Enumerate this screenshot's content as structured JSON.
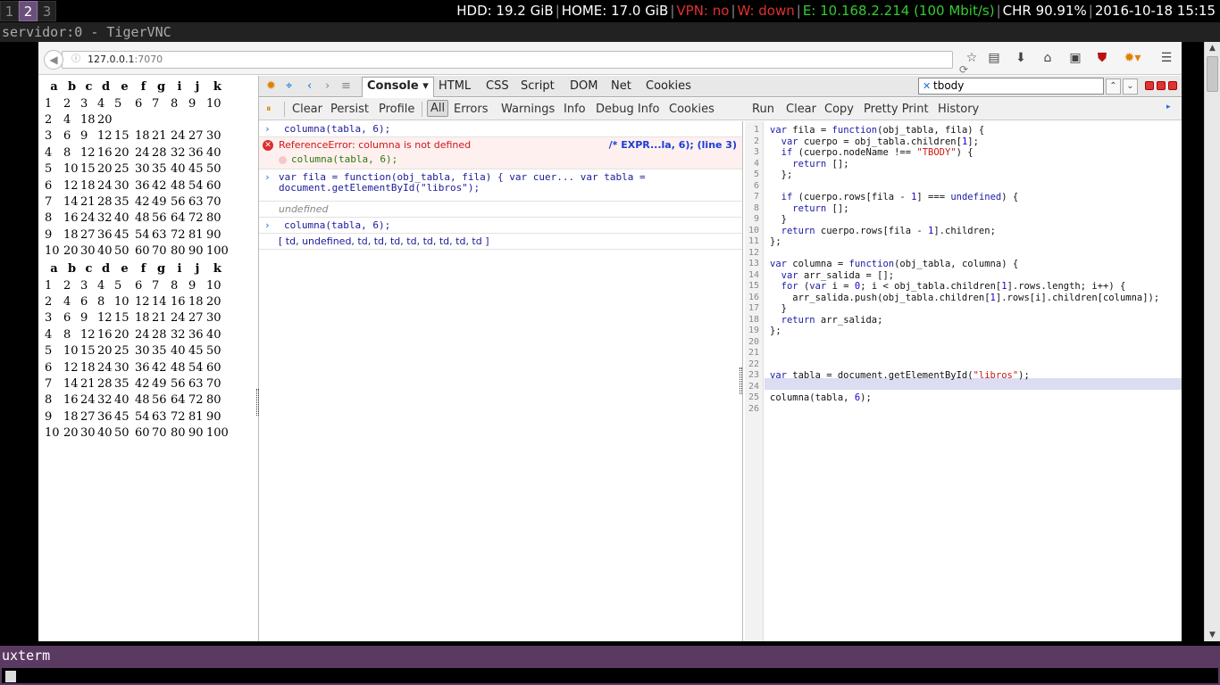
{
  "topbar": {
    "workspaces": [
      "1",
      "2",
      "3"
    ],
    "status": {
      "hdd": "HDD: 19.2 GiB",
      "home": "HOME: 17.0 GiB",
      "vpn": "VPN: no",
      "wifi": "W: down",
      "eth": "E: 10.168.2.214 (100 Mbit/s)",
      "battery": "CHR 90.91%",
      "datetime": "2016-10-18 15:15"
    },
    "colors": {
      "red": "#e03030",
      "green": "#33cc33",
      "white": "#ffffff"
    }
  },
  "vnc_title": "servidor:0 - TigerVNC",
  "browser": {
    "url_host": "127.0.0.1",
    "url_port": ":7070",
    "info_icon": "info-icon",
    "toolbar_icons": [
      "star-icon",
      "reading-list-icon",
      "download-icon",
      "home-icon",
      "pocket-icon",
      "ublock-icon",
      "firebug-icon",
      "menu-icon"
    ]
  },
  "page": {
    "headers": [
      "a",
      "b",
      "c",
      "d",
      "e",
      "f",
      "g",
      "i",
      "j",
      "k"
    ],
    "table1": [
      [
        "1",
        "2",
        "3",
        "4",
        "5",
        "6",
        "7",
        "8",
        "9",
        "10"
      ],
      [
        "2",
        "4",
        "18",
        "20",
        "",
        "",
        "",
        "",
        "",
        ""
      ],
      [
        "3",
        "6",
        "9",
        "12",
        "15",
        "18",
        "21",
        "24",
        "27",
        "30"
      ],
      [
        "4",
        "8",
        "12",
        "16",
        "20",
        "24",
        "28",
        "32",
        "36",
        "40"
      ],
      [
        "5",
        "10",
        "15",
        "20",
        "25",
        "30",
        "35",
        "40",
        "45",
        "50"
      ],
      [
        "6",
        "12",
        "18",
        "24",
        "30",
        "36",
        "42",
        "48",
        "54",
        "60"
      ],
      [
        "7",
        "14",
        "21",
        "28",
        "35",
        "42",
        "49",
        "56",
        "63",
        "70"
      ],
      [
        "8",
        "16",
        "24",
        "32",
        "40",
        "48",
        "56",
        "64",
        "72",
        "80"
      ],
      [
        "9",
        "18",
        "27",
        "36",
        "45",
        "54",
        "63",
        "72",
        "81",
        "90"
      ],
      [
        "10",
        "20",
        "30",
        "40",
        "50",
        "60",
        "70",
        "80",
        "90",
        "100"
      ]
    ],
    "table2": [
      [
        "1",
        "2",
        "3",
        "4",
        "5",
        "6",
        "7",
        "8",
        "9",
        "10"
      ],
      [
        "2",
        "4",
        "6",
        "8",
        "10",
        "12",
        "14",
        "16",
        "18",
        "20"
      ],
      [
        "3",
        "6",
        "9",
        "12",
        "15",
        "18",
        "21",
        "24",
        "27",
        "30"
      ],
      [
        "4",
        "8",
        "12",
        "16",
        "20",
        "24",
        "28",
        "32",
        "36",
        "40"
      ],
      [
        "5",
        "10",
        "15",
        "20",
        "25",
        "30",
        "35",
        "40",
        "45",
        "50"
      ],
      [
        "6",
        "12",
        "18",
        "24",
        "30",
        "36",
        "42",
        "48",
        "54",
        "60"
      ],
      [
        "7",
        "14",
        "21",
        "28",
        "35",
        "42",
        "49",
        "56",
        "63",
        "70"
      ],
      [
        "8",
        "16",
        "24",
        "32",
        "40",
        "48",
        "56",
        "64",
        "72",
        "80"
      ],
      [
        "9",
        "18",
        "27",
        "36",
        "45",
        "54",
        "63",
        "72",
        "81",
        "90"
      ],
      [
        "10",
        "20",
        "30",
        "40",
        "50",
        "60",
        "70",
        "80",
        "90",
        "100"
      ]
    ]
  },
  "firebug": {
    "tabs": [
      "Console",
      "HTML",
      "CSS",
      "Script",
      "DOM",
      "Net",
      "Cookies"
    ],
    "search_value": "tbody",
    "console_tools": [
      "Clear",
      "Persist",
      "Profile",
      "All",
      "Errors",
      "Warnings",
      "Info",
      "Debug Info",
      "Cookies"
    ],
    "editor_tools": [
      "Run",
      "Clear",
      "Copy",
      "Pretty Print",
      "History"
    ],
    "log": [
      {
        "kind": "cmd",
        "text": "columna(tabla, 6);"
      },
      {
        "kind": "error",
        "message": "ReferenceError: columna is not defined",
        "location": "/* EXPR...la, 6); (line 3)",
        "source": "columna(tabla, 6);"
      },
      {
        "kind": "cmd",
        "text": "var fila = function(obj_tabla, fila) {   var cuer...  var tabla =",
        "text2": "document.getElementById(\"libros\");"
      },
      {
        "kind": "undef",
        "text": "undefined"
      },
      {
        "kind": "cmd",
        "text": "columna(tabla, 6);"
      },
      {
        "kind": "result",
        "text": "[ td, undefined, td, td, td, td, td, td, td, td ]"
      }
    ],
    "code_lines": [
      "var fila = function(obj_tabla, fila) {",
      "  var cuerpo = obj_tabla.children[1];",
      "  if (cuerpo.nodeName !== \"TBODY\") {",
      "    return [];",
      "  };",
      "",
      "  if (cuerpo.rows[fila - 1] === undefined) {",
      "    return [];",
      "  }",
      "  return cuerpo.rows[fila - 1].children;",
      "};",
      "",
      "var columna = function(obj_tabla, columna) {",
      "  var arr_salida = [];",
      "  for (var i = 0; i < obj_tabla.children[1].rows.length; i++) {",
      "    arr_salida.push(obj_tabla.children[1].rows[i].children[columna]);",
      "  }",
      "  return arr_salida;",
      "};",
      "",
      "",
      "",
      "var tabla = document.getElementById(\"libros\");",
      "",
      "columna(tabla, 6);",
      ""
    ]
  },
  "xterm_title": "uxterm"
}
